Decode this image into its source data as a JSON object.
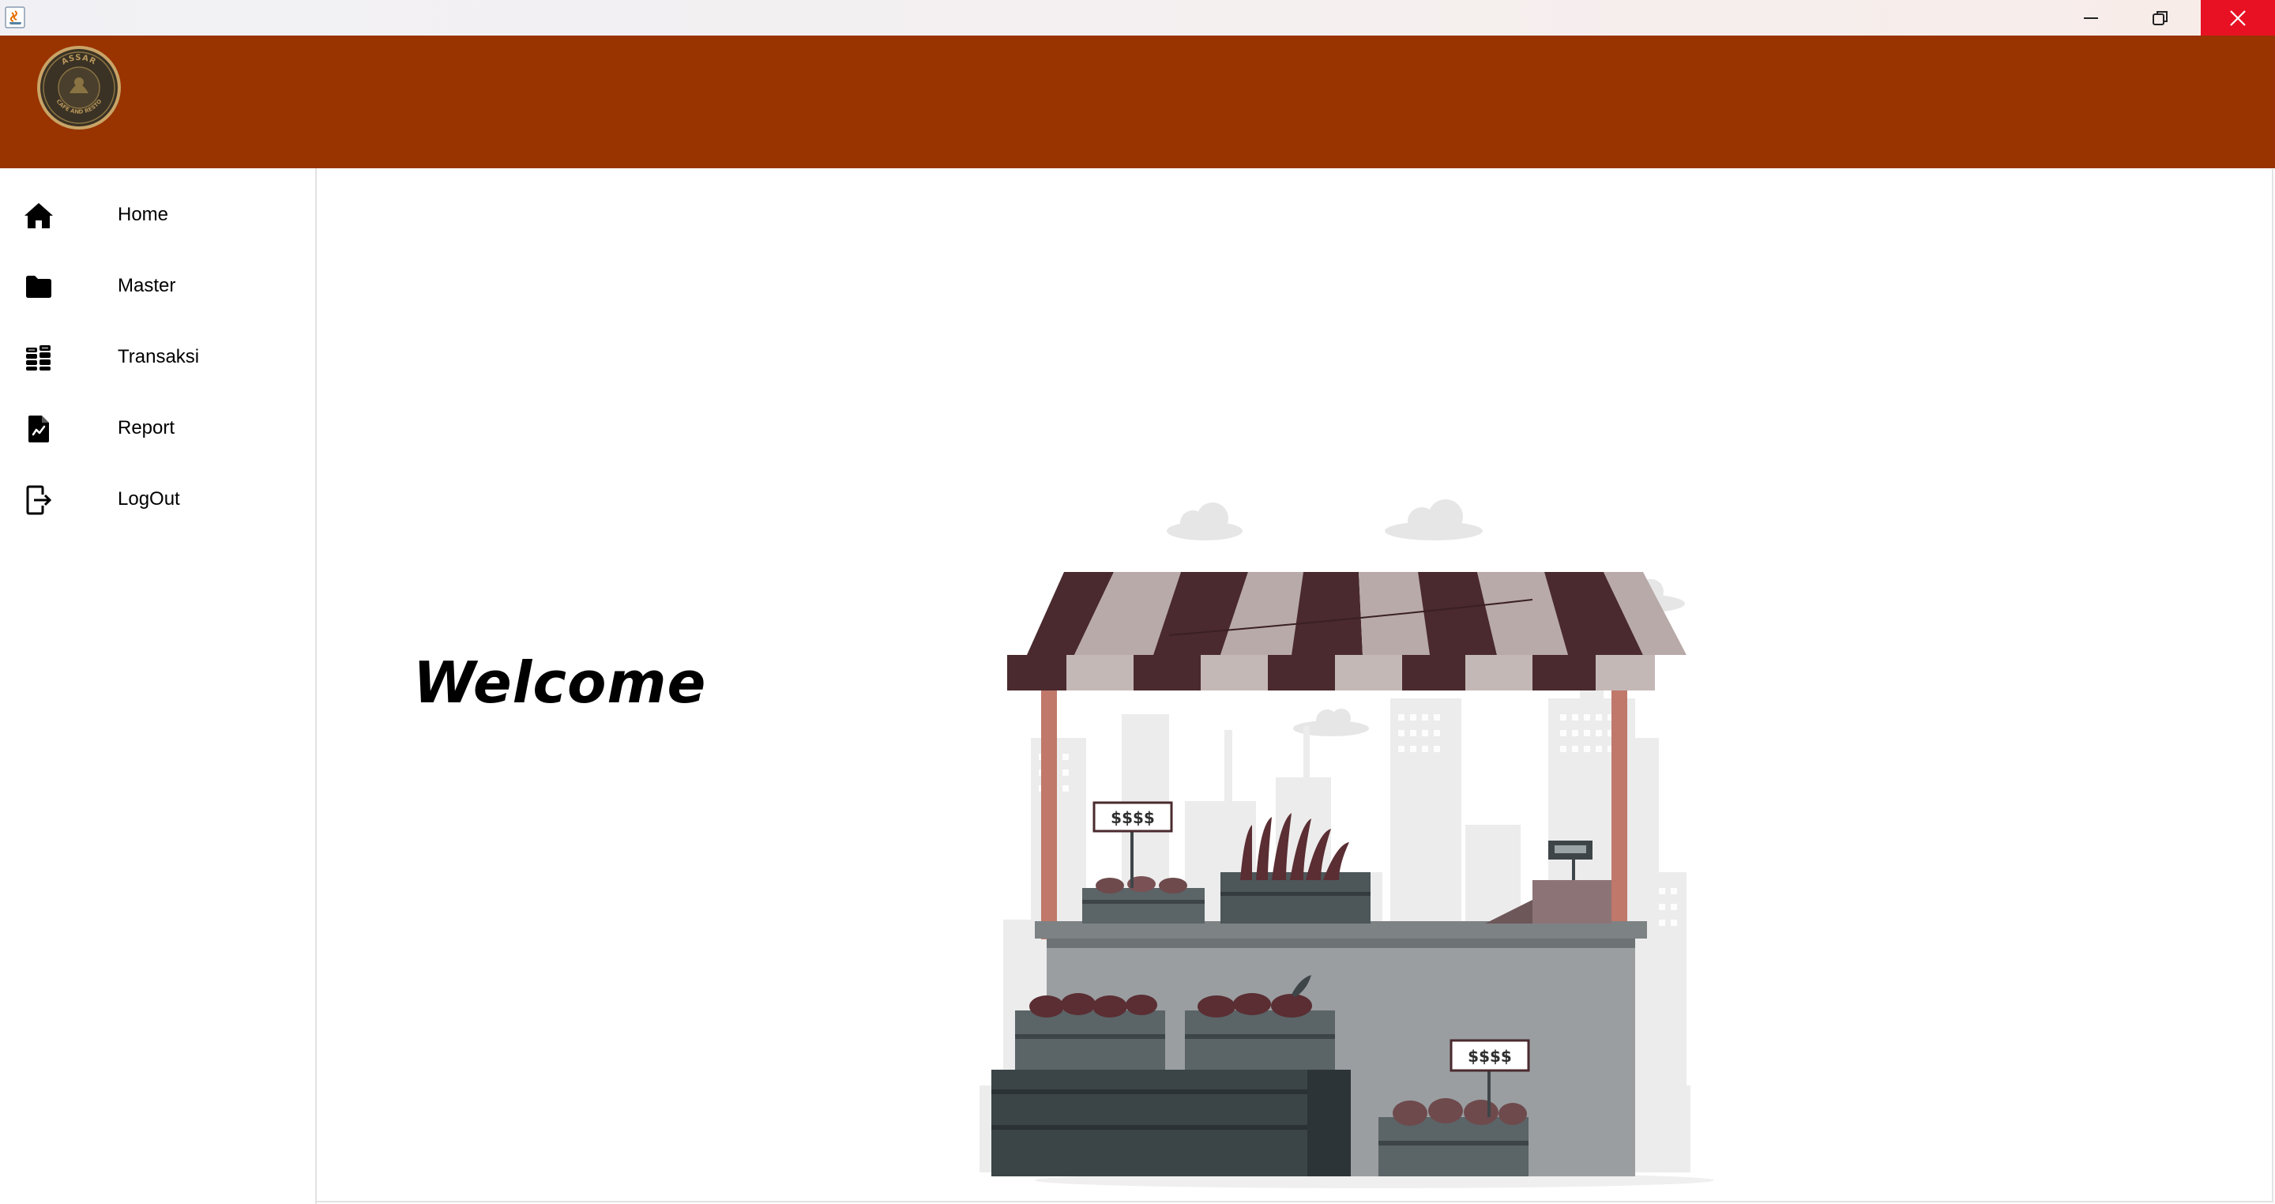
{
  "window": {
    "controls": {
      "minimize_icon": "minimize-icon",
      "maximize_icon": "restore-icon",
      "close_icon": "close-icon"
    },
    "close_color": "#e81123"
  },
  "header": {
    "background_color": "#993300",
    "logo_text": "ASSAR CAFE AND RESTO"
  },
  "sidebar": {
    "items": [
      {
        "label": "Home",
        "icon": "home-icon"
      },
      {
        "label": "Master",
        "icon": "folder-icon"
      },
      {
        "label": "Transaksi",
        "icon": "coins-icon"
      },
      {
        "label": "Report",
        "icon": "report-icon"
      },
      {
        "label": "LogOut",
        "icon": "logout-icon"
      }
    ]
  },
  "main": {
    "welcome_text": "Welcome",
    "illustration": {
      "price_tag_1": "$$$$",
      "price_tag_2": "$$$$"
    }
  }
}
